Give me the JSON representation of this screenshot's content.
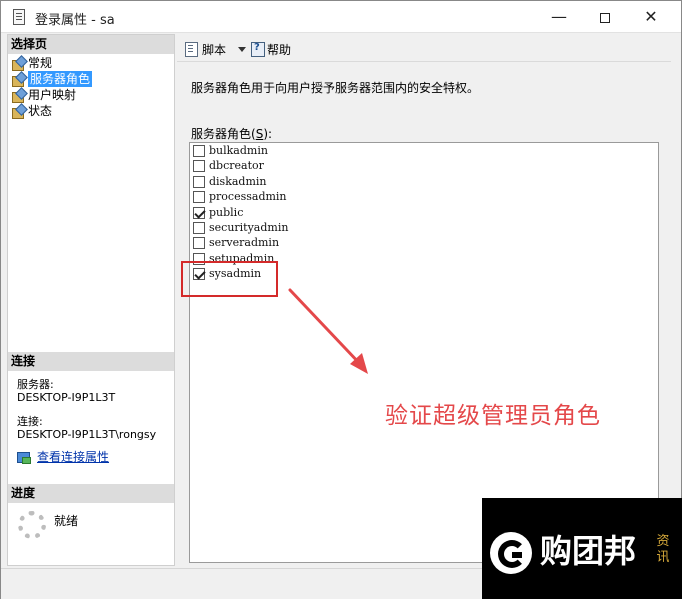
{
  "window": {
    "title": "登录属性 - sa",
    "minimize_glyph": "—",
    "close_glyph": "✕"
  },
  "left_pane": {
    "select_page_header": "选择页",
    "nav_items": [
      {
        "label": "常规",
        "selected": false
      },
      {
        "label": "服务器角色",
        "selected": true
      },
      {
        "label": "用户映射",
        "selected": false
      },
      {
        "label": "状态",
        "selected": false
      }
    ],
    "connection": {
      "header": "连接",
      "server_label": "服务器:",
      "server_value": "DESKTOP-I9P1L3T",
      "connection_label": "连接:",
      "connection_value": "DESKTOP-I9P1L3T\\rongsy",
      "view_properties_link": "查看连接属性"
    },
    "progress": {
      "header": "进度",
      "status": "就绪"
    }
  },
  "toolbar": {
    "script_label": "脚本",
    "help_label": "帮助"
  },
  "main": {
    "description": "服务器角色用于向用户授予服务器范围内的安全特权。",
    "roles_label_prefix": "服务器角色(",
    "roles_label_key": "S",
    "roles_label_suffix": "):",
    "roles": [
      {
        "name": "bulkadmin",
        "checked": false
      },
      {
        "name": "dbcreator",
        "checked": false
      },
      {
        "name": "diskadmin",
        "checked": false
      },
      {
        "name": "processadmin",
        "checked": false
      },
      {
        "name": "public",
        "checked": true
      },
      {
        "name": "securityadmin",
        "checked": false
      },
      {
        "name": "serveradmin",
        "checked": false
      },
      {
        "name": "setupadmin",
        "checked": false
      },
      {
        "name": "sysadmin",
        "checked": true
      }
    ]
  },
  "annotation": {
    "text": "验证超级管理员角色",
    "color": "#e4484a"
  },
  "watermark": {
    "brand": "购团邦",
    "side_text": "资讯"
  },
  "colors": {
    "selection": "#3399ff",
    "link": "#0033aa",
    "highlight_box": "#d42a2a"
  }
}
